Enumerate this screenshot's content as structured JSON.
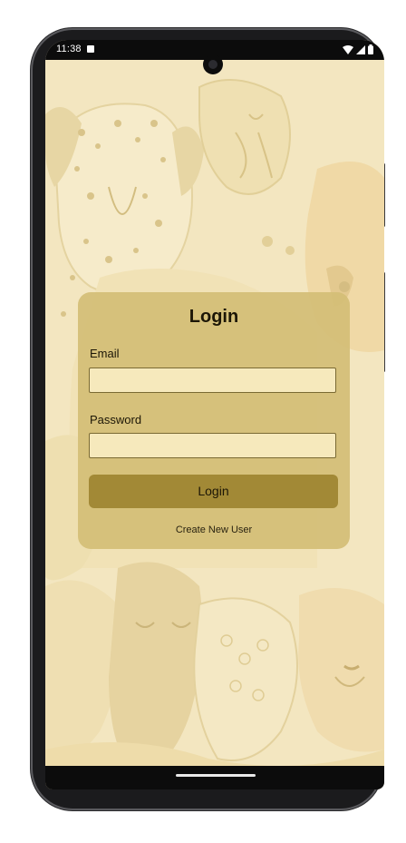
{
  "status_bar": {
    "time": "11:38",
    "icons": [
      "notification-icon",
      "wifi-icon",
      "signal-icon",
      "battery-icon"
    ]
  },
  "login_card": {
    "title": "Login",
    "email_label": "Email",
    "email_value": "",
    "password_label": "Password",
    "password_value": "",
    "login_button_label": "Login",
    "create_user_link": "Create New User"
  },
  "colors": {
    "background": "#f3e6c0",
    "card": "#d4be76",
    "button": "#a28936",
    "input": "#f6e9bc"
  }
}
